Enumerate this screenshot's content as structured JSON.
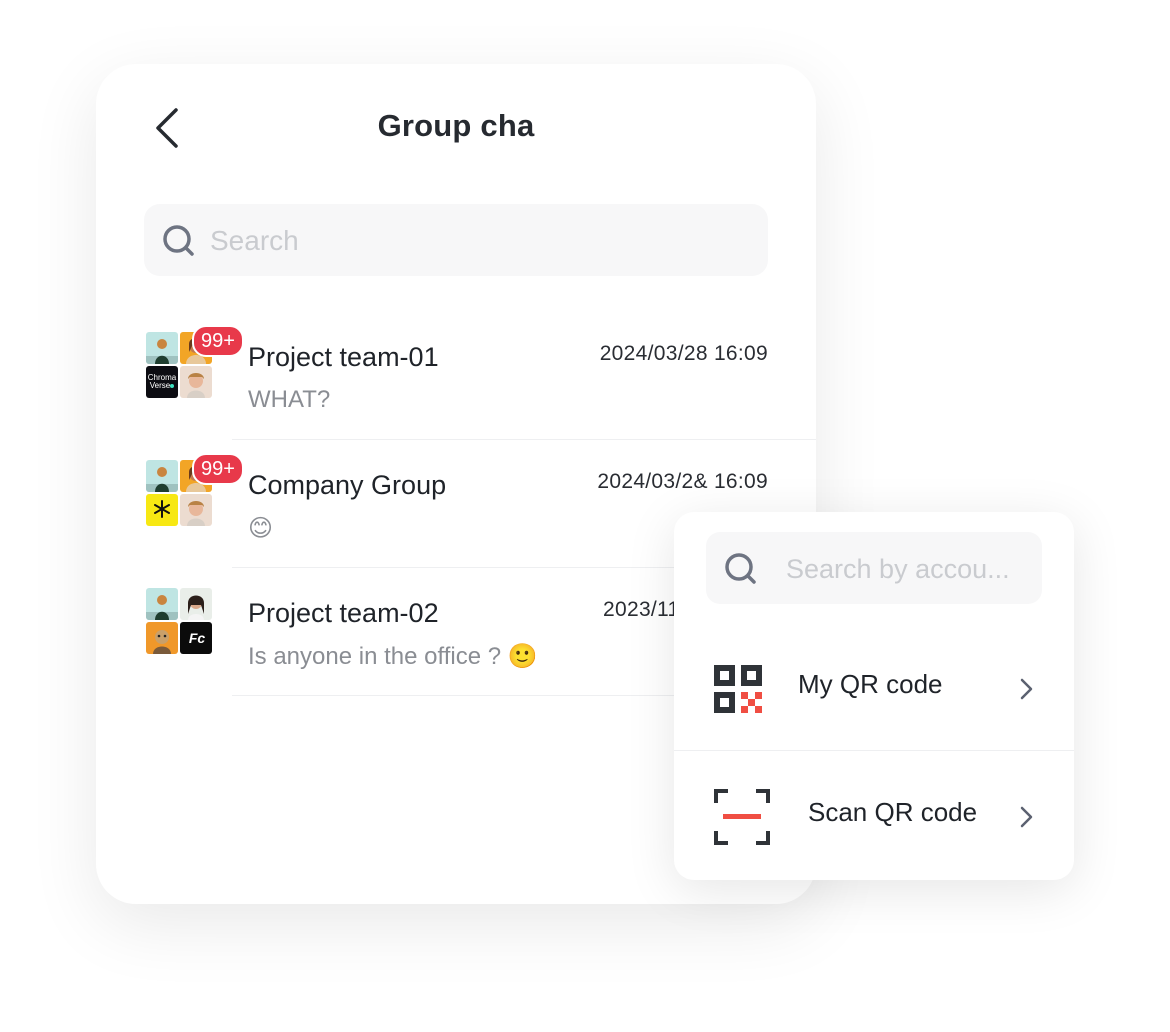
{
  "header": {
    "title": "Group cha"
  },
  "search": {
    "placeholder": "Search"
  },
  "chats": [
    {
      "name": "Project team-01",
      "time": "2024/03/28 16:09",
      "preview": "WHAT?",
      "badge": "99+"
    },
    {
      "name": "Company Group",
      "time": "2024/03/2& 16:09",
      "preview": "😊",
      "badge": "99+"
    },
    {
      "name": "Project team-02",
      "time": "2023/11",
      "preview": "Is anyone in the office ? 🙂"
    }
  ],
  "avatar_tiles": {
    "chromaverse_logo": [
      "Chroma",
      "Verse"
    ],
    "fc_logo": "Fc"
  },
  "popup": {
    "search_placeholder": "Search by accou...",
    "items": [
      {
        "label": "My QR code",
        "icon": "qr-code-icon"
      },
      {
        "label": "Scan QR code",
        "icon": "scan-icon"
      }
    ]
  },
  "colors": {
    "badge": "#e8394a",
    "accent": "#f04e43",
    "title": "#262a30",
    "muted": "#8a8d93"
  }
}
